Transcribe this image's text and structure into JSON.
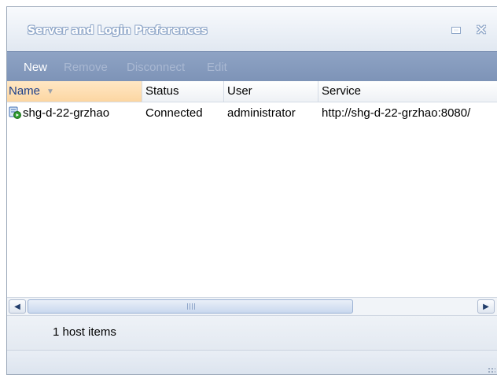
{
  "window": {
    "title": "Server and Login Preferences",
    "maximize_icon": "maximize-icon",
    "close_glyph": "✕"
  },
  "toolbar": {
    "new_label": "New",
    "remove_label": "Remove",
    "disconnect_label": "Disconnect",
    "edit_label": "Edit",
    "disabled_color": "#a9b8d2",
    "enabled_color": "#ffffff"
  },
  "table": {
    "columns": [
      "Name",
      "Status",
      "User",
      "Service"
    ],
    "sort_glyph": "▼",
    "rows": [
      {
        "icon": "server-connected-icon",
        "name": "shg-d-22-grzhao",
        "status": "Connected",
        "user": "administrator",
        "service": "http://shg-d-22-grzhao:8080/"
      }
    ]
  },
  "scrollbar": {
    "left_glyph": "◀",
    "right_glyph": "▶"
  },
  "status": {
    "text": "1 host items"
  },
  "colors": {
    "toolbar_bg": "#8ea3c4",
    "header_sorted_bg": "#fcd6a2",
    "window_bg": "#eef2f7"
  }
}
